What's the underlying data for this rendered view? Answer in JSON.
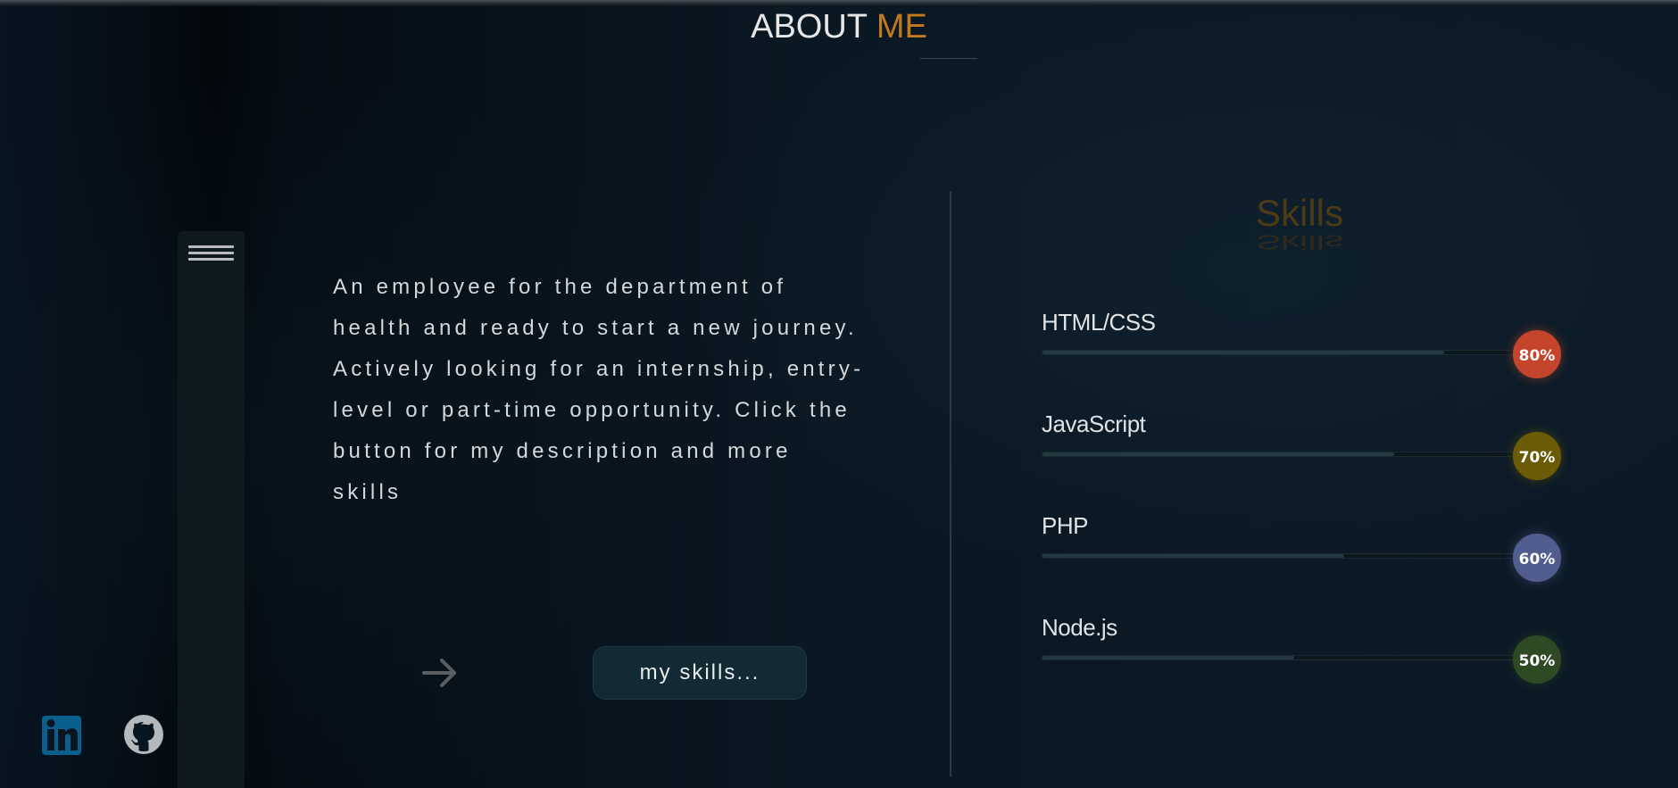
{
  "header": {
    "title_part1": "ABOUT",
    "title_part2": "ME",
    "title_part2_color": "#c37a1d"
  },
  "sidebar": {
    "menu_icon": "hamburger-menu-icon"
  },
  "social": {
    "linkedin_icon": "linkedin-icon",
    "github_icon": "github-icon"
  },
  "about": {
    "text": "An employee for the department of health and ready to start a new journey. Actively looking for an internship, entry-level or part-time opportunity. Click the button for my description and more skills",
    "arrow_icon": "arrow-right-icon",
    "button_label": "my skills..."
  },
  "skills": {
    "heading": "Skills",
    "items": [
      {
        "name": "HTML/CSS",
        "percent": 80,
        "label": "80%",
        "badge_color": "#c4452b"
      },
      {
        "name": "JavaScript",
        "percent": 70,
        "label": "70%",
        "badge_color": "#6b5a06"
      },
      {
        "name": "PHP",
        "percent": 60,
        "label": "60%",
        "badge_color": "#525d8f"
      },
      {
        "name": "Node.js",
        "percent": 50,
        "label": "50%",
        "badge_color": "#2e4a25"
      }
    ]
  }
}
